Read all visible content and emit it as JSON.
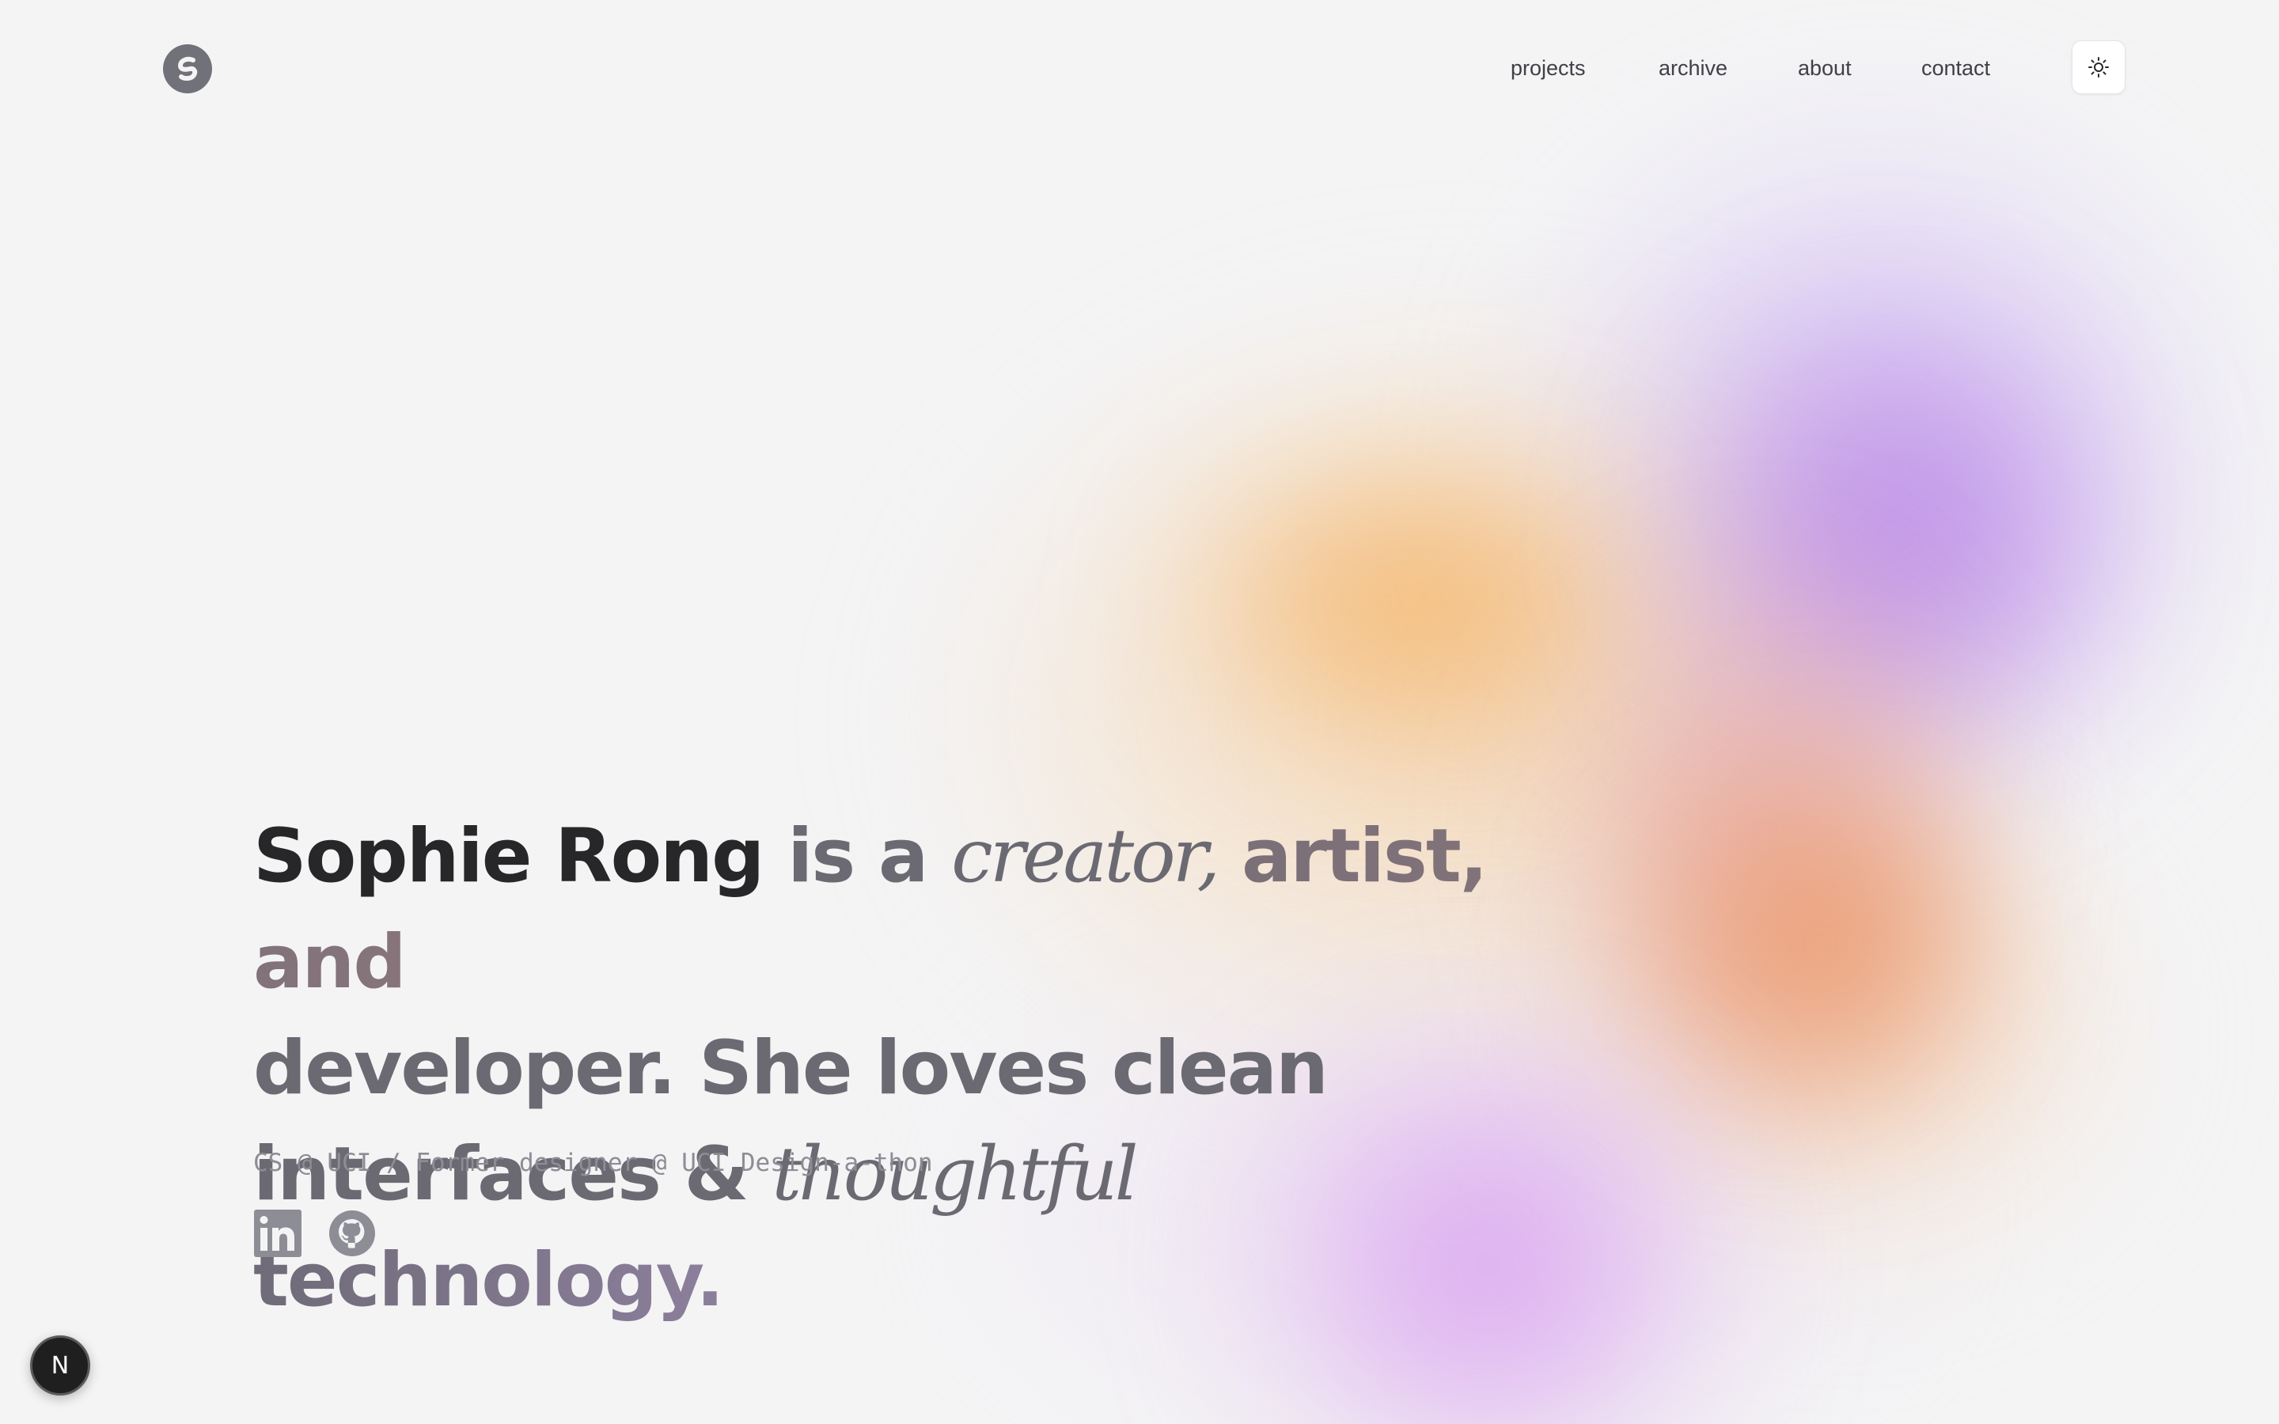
{
  "header": {
    "logo_icon": "swirl-s-logo-icon",
    "nav": [
      {
        "label": "projects"
      },
      {
        "label": "archive"
      },
      {
        "label": "about"
      },
      {
        "label": "contact"
      }
    ],
    "theme_toggle_icon": "sun-icon"
  },
  "hero": {
    "name": "Sophie Rong",
    "text_1": " is a ",
    "creator": "creator,",
    "text_2": " artist, and",
    "line_2": "developer. She loves clean",
    "line_3a": "interfaces & ",
    "thoughtful": "thoughtful",
    "line_3b": " technology."
  },
  "subtitle": "CS @ UCI / Former designer @ UCI Design-a-thon",
  "socials": [
    {
      "icon": "linkedin-icon"
    },
    {
      "icon": "github-icon"
    }
  ],
  "dev_badge": {
    "label": "N",
    "icon": "nextjs-icon"
  },
  "colors": {
    "background": "#f4f4f5",
    "name_text": "#27272a",
    "body_text": "#6b6a73",
    "muted": "#8d8d96"
  }
}
